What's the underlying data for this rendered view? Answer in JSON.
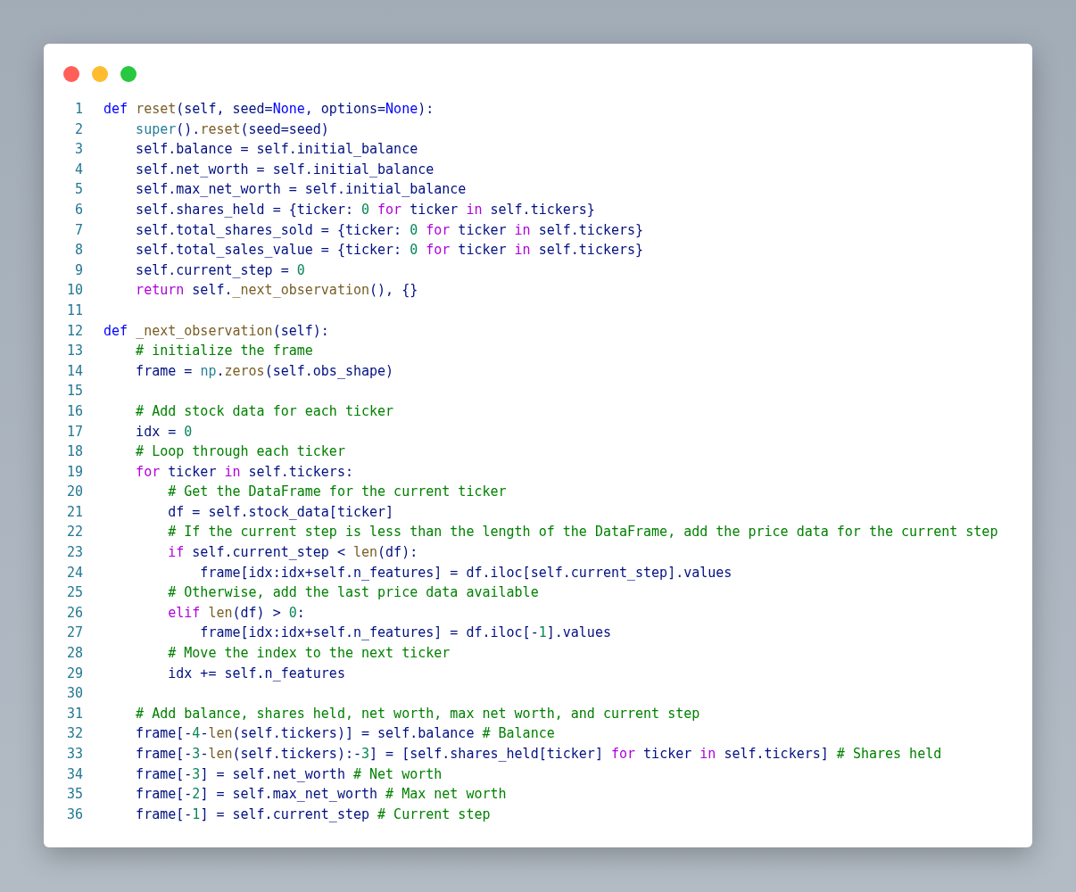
{
  "window": {
    "controls": [
      {
        "kind": "close"
      },
      {
        "kind": "minimize"
      },
      {
        "kind": "zoom"
      }
    ]
  },
  "code": {
    "lines": [
      {
        "number": "1",
        "tokens": [
          {
            "kind": "keyword",
            "text": "def "
          },
          {
            "kind": "function",
            "text": "reset"
          },
          {
            "kind": "name",
            "text": "(self, seed="
          },
          {
            "kind": "keyword",
            "text": "None"
          },
          {
            "kind": "name",
            "text": ", options="
          },
          {
            "kind": "keyword",
            "text": "None"
          },
          {
            "kind": "name",
            "text": "):"
          }
        ]
      },
      {
        "number": "2",
        "tokens": [
          {
            "kind": "builtin",
            "text": "    super"
          },
          {
            "kind": "name",
            "text": "()."
          },
          {
            "kind": "function",
            "text": "reset"
          },
          {
            "kind": "name",
            "text": "(seed=seed)"
          }
        ]
      },
      {
        "number": "3",
        "tokens": [
          {
            "kind": "name",
            "text": "    self.balance = self.initial_balance"
          }
        ]
      },
      {
        "number": "4",
        "tokens": [
          {
            "kind": "name",
            "text": "    self.net_worth = self.initial_balance"
          }
        ]
      },
      {
        "number": "5",
        "tokens": [
          {
            "kind": "name",
            "text": "    self.max_net_worth = self.initial_balance"
          }
        ]
      },
      {
        "number": "6",
        "tokens": [
          {
            "kind": "name",
            "text": "    self.shares_held = {ticker: "
          },
          {
            "kind": "number",
            "text": "0"
          },
          {
            "kind": "control",
            "text": " for"
          },
          {
            "kind": "name",
            "text": " ticker "
          },
          {
            "kind": "control",
            "text": "in"
          },
          {
            "kind": "name",
            "text": " self.tickers}"
          }
        ]
      },
      {
        "number": "7",
        "tokens": [
          {
            "kind": "name",
            "text": "    self.total_shares_sold = {ticker: "
          },
          {
            "kind": "number",
            "text": "0"
          },
          {
            "kind": "control",
            "text": " for"
          },
          {
            "kind": "name",
            "text": " ticker "
          },
          {
            "kind": "control",
            "text": "in"
          },
          {
            "kind": "name",
            "text": " self.tickers}"
          }
        ]
      },
      {
        "number": "8",
        "tokens": [
          {
            "kind": "name",
            "text": "    self.total_sales_value = {ticker: "
          },
          {
            "kind": "number",
            "text": "0"
          },
          {
            "kind": "control",
            "text": " for"
          },
          {
            "kind": "name",
            "text": " ticker "
          },
          {
            "kind": "control",
            "text": "in"
          },
          {
            "kind": "name",
            "text": " self.tickers}"
          }
        ]
      },
      {
        "number": "9",
        "tokens": [
          {
            "kind": "name",
            "text": "    self.current_step = "
          },
          {
            "kind": "number",
            "text": "0"
          }
        ]
      },
      {
        "number": "10",
        "tokens": [
          {
            "kind": "control",
            "text": "    return"
          },
          {
            "kind": "name",
            "text": " self."
          },
          {
            "kind": "function",
            "text": "_next_observation"
          },
          {
            "kind": "name",
            "text": "(), {}"
          }
        ]
      },
      {
        "number": "11"
      },
      {
        "number": "12",
        "tokens": [
          {
            "kind": "keyword",
            "text": "def "
          },
          {
            "kind": "function",
            "text": "_next_observation"
          },
          {
            "kind": "name",
            "text": "(self):"
          }
        ]
      },
      {
        "number": "13",
        "tokens": [
          {
            "kind": "comment",
            "text": "    # initialize the frame"
          }
        ]
      },
      {
        "number": "14",
        "tokens": [
          {
            "kind": "name",
            "text": "    frame = "
          },
          {
            "kind": "builtin",
            "text": "np"
          },
          {
            "kind": "name",
            "text": "."
          },
          {
            "kind": "function",
            "text": "zeros"
          },
          {
            "kind": "name",
            "text": "(self.obs_shape)"
          }
        ]
      },
      {
        "number": "15"
      },
      {
        "number": "16",
        "tokens": [
          {
            "kind": "comment",
            "text": "    # Add stock data for each ticker"
          }
        ]
      },
      {
        "number": "17",
        "tokens": [
          {
            "kind": "name",
            "text": "    idx = "
          },
          {
            "kind": "number",
            "text": "0"
          }
        ]
      },
      {
        "number": "18",
        "tokens": [
          {
            "kind": "comment",
            "text": "    # Loop through each ticker"
          }
        ]
      },
      {
        "number": "19",
        "tokens": [
          {
            "kind": "control",
            "text": "    for"
          },
          {
            "kind": "name",
            "text": " ticker "
          },
          {
            "kind": "control",
            "text": "in"
          },
          {
            "kind": "name",
            "text": " self.tickers:"
          }
        ]
      },
      {
        "number": "20",
        "tokens": [
          {
            "kind": "comment",
            "text": "        # Get the DataFrame for the current ticker"
          }
        ]
      },
      {
        "number": "21",
        "tokens": [
          {
            "kind": "name",
            "text": "        df = self.stock_data[ticker]"
          }
        ]
      },
      {
        "number": "22",
        "tokens": [
          {
            "kind": "comment",
            "text": "        # If the current step is less than the length of the DataFrame, add the price data for the current step"
          }
        ]
      },
      {
        "number": "23",
        "tokens": [
          {
            "kind": "control",
            "text": "        if"
          },
          {
            "kind": "name",
            "text": " self.current_step < "
          },
          {
            "kind": "function",
            "text": "len"
          },
          {
            "kind": "name",
            "text": "(df):"
          }
        ]
      },
      {
        "number": "24",
        "tokens": [
          {
            "kind": "name",
            "text": "            frame[idx:idx+self.n_features] = df.iloc[self.current_step].values"
          }
        ]
      },
      {
        "number": "25",
        "tokens": [
          {
            "kind": "comment",
            "text": "        # Otherwise, add the last price data available"
          }
        ]
      },
      {
        "number": "26",
        "tokens": [
          {
            "kind": "control",
            "text": "        elif "
          },
          {
            "kind": "function",
            "text": "len"
          },
          {
            "kind": "name",
            "text": "(df) > "
          },
          {
            "kind": "number",
            "text": "0"
          },
          {
            "kind": "name",
            "text": ":"
          }
        ]
      },
      {
        "number": "27",
        "tokens": [
          {
            "kind": "name",
            "text": "            frame[idx:idx+self.n_features] = df.iloc[-"
          },
          {
            "kind": "number",
            "text": "1"
          },
          {
            "kind": "name",
            "text": "].values"
          }
        ]
      },
      {
        "number": "28",
        "tokens": [
          {
            "kind": "comment",
            "text": "        # Move the index to the next ticker"
          }
        ]
      },
      {
        "number": "29",
        "tokens": [
          {
            "kind": "name",
            "text": "        idx += self.n_features"
          }
        ]
      },
      {
        "number": "30"
      },
      {
        "number": "31",
        "tokens": [
          {
            "kind": "comment",
            "text": "    # Add balance, shares held, net worth, max net worth, and current step"
          }
        ]
      },
      {
        "number": "32",
        "tokens": [
          {
            "kind": "name",
            "text": "    frame[-"
          },
          {
            "kind": "number",
            "text": "4"
          },
          {
            "kind": "name",
            "text": "-"
          },
          {
            "kind": "function",
            "text": "len"
          },
          {
            "kind": "name",
            "text": "(self.tickers)] = self.balance "
          },
          {
            "kind": "comment",
            "text": "# Balance"
          }
        ]
      },
      {
        "number": "33",
        "tokens": [
          {
            "kind": "name",
            "text": "    frame[-"
          },
          {
            "kind": "number",
            "text": "3"
          },
          {
            "kind": "name",
            "text": "-"
          },
          {
            "kind": "function",
            "text": "len"
          },
          {
            "kind": "name",
            "text": "(self.tickers):-"
          },
          {
            "kind": "number",
            "text": "3"
          },
          {
            "kind": "name",
            "text": "] = [self.shares_held[ticker] "
          },
          {
            "kind": "control",
            "text": "for"
          },
          {
            "kind": "name",
            "text": " ticker "
          },
          {
            "kind": "control",
            "text": "in"
          },
          {
            "kind": "name",
            "text": " self.tickers] "
          },
          {
            "kind": "comment",
            "text": "# Shares held"
          }
        ]
      },
      {
        "number": "34",
        "tokens": [
          {
            "kind": "name",
            "text": "    frame[-"
          },
          {
            "kind": "number",
            "text": "3"
          },
          {
            "kind": "name",
            "text": "] = self.net_worth "
          },
          {
            "kind": "comment",
            "text": "# Net worth"
          }
        ]
      },
      {
        "number": "35",
        "tokens": [
          {
            "kind": "name",
            "text": "    frame[-"
          },
          {
            "kind": "number",
            "text": "2"
          },
          {
            "kind": "name",
            "text": "] = self.max_net_worth "
          },
          {
            "kind": "comment",
            "text": "# Max net worth"
          }
        ]
      },
      {
        "number": "36",
        "tokens": [
          {
            "kind": "name",
            "text": "    frame[-"
          },
          {
            "kind": "number",
            "text": "1"
          },
          {
            "kind": "name",
            "text": "] = self.current_step "
          },
          {
            "kind": "comment",
            "text": "# Current step"
          }
        ]
      }
    ]
  }
}
